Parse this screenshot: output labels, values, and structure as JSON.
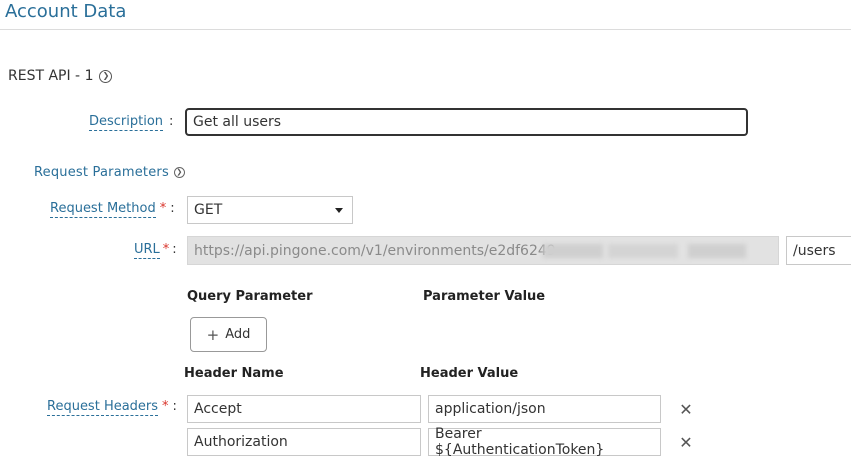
{
  "page": {
    "title": "Account Data"
  },
  "section": {
    "title": "REST API - 1",
    "icon": "circle-chevron-icon"
  },
  "description": {
    "label": "Description",
    "colon": ":",
    "value": "Get all users"
  },
  "request_parameters": {
    "title": "Request Parameters",
    "icon": "circle-chevron-icon"
  },
  "request_method": {
    "label": "Request Method",
    "required": "*",
    "colon": ":",
    "value": "GET"
  },
  "url": {
    "label": "URL",
    "required": "*",
    "colon": ":",
    "value": "https://api.pingone.com/v1/environments/e2df6249-",
    "suffix": "/users"
  },
  "query": {
    "param_header": "Query Parameter",
    "value_header": "Parameter Value",
    "add_label": "Add",
    "add_icon": "+"
  },
  "headers": {
    "name_header": "Header Name",
    "value_header": "Header Value",
    "label": "Request Headers",
    "required": "*",
    "colon": ":",
    "remove_icon": "✕",
    "rows": [
      {
        "name": "Accept",
        "value": "application/json"
      },
      {
        "name": "Authorization",
        "value": "Bearer ${AuthenticationToken}"
      }
    ]
  }
}
